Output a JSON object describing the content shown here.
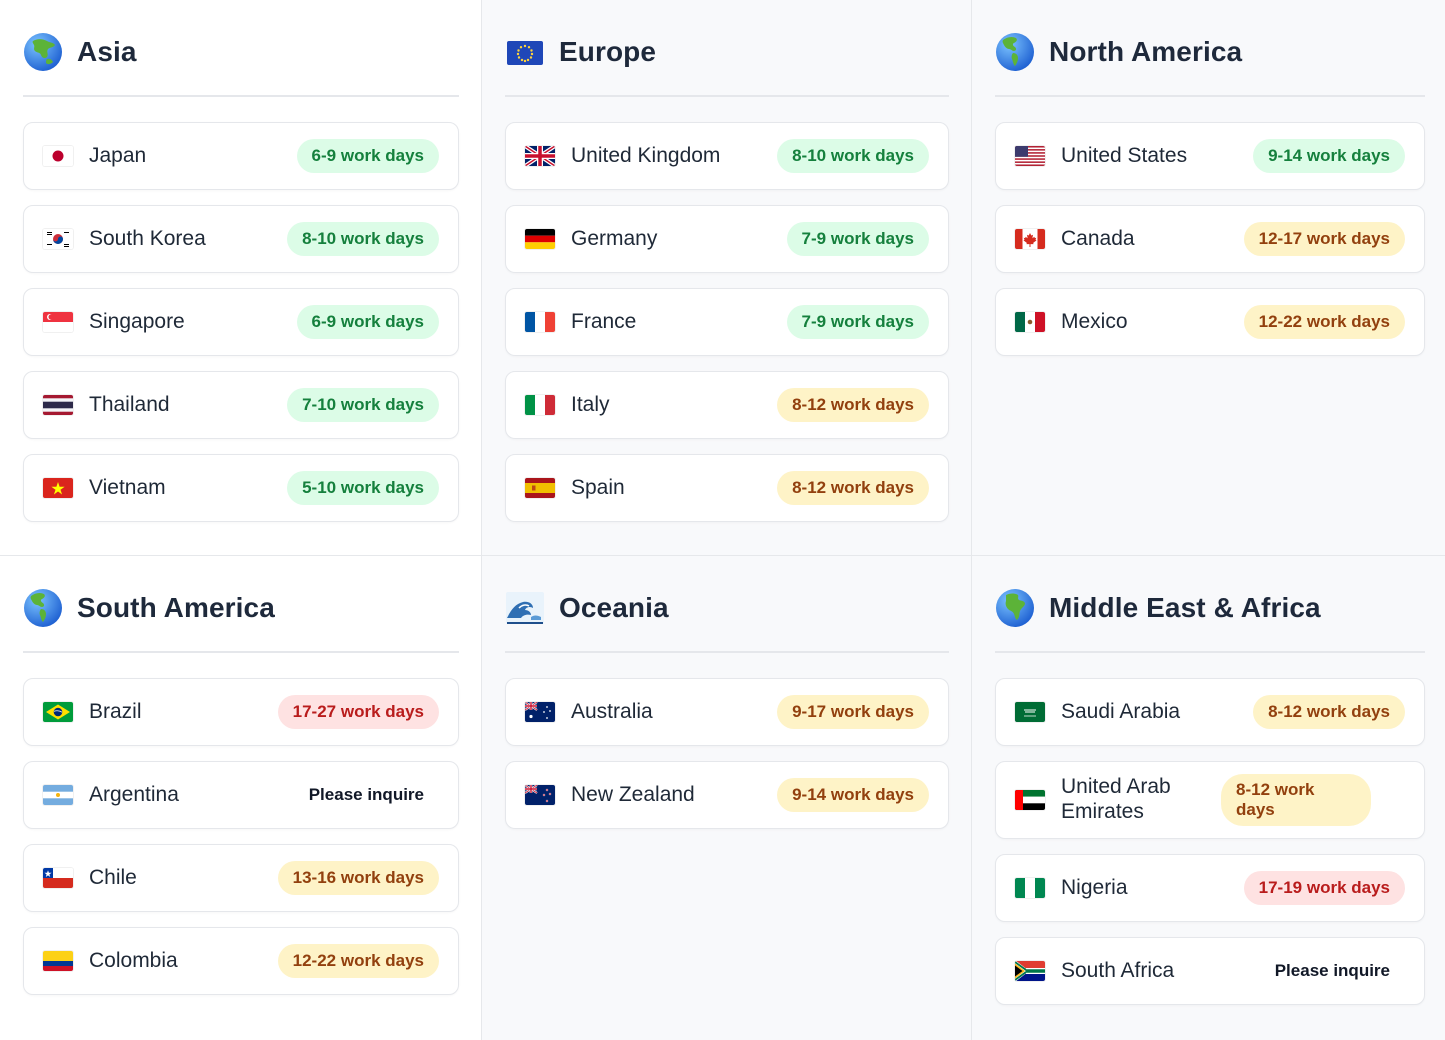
{
  "regions": [
    {
      "title": "Asia",
      "icon": "globe-asia-icon",
      "countries": [
        {
          "name": "Japan",
          "flag": "japan-flag-icon",
          "badge": "6-9 work days",
          "status": "green"
        },
        {
          "name": "South Korea",
          "flag": "south-korea-flag-icon",
          "badge": "8-10 work days",
          "status": "green"
        },
        {
          "name": "Singapore",
          "flag": "singapore-flag-icon",
          "badge": "6-9 work days",
          "status": "green"
        },
        {
          "name": "Thailand",
          "flag": "thailand-flag-icon",
          "badge": "7-10 work days",
          "status": "green"
        },
        {
          "name": "Vietnam",
          "flag": "vietnam-flag-icon",
          "badge": "5-10 work days",
          "status": "green"
        }
      ]
    },
    {
      "title": "Europe",
      "icon": "eu-flag-icon",
      "countries": [
        {
          "name": "United Kingdom",
          "flag": "uk-flag-icon",
          "badge": "8-10 work days",
          "status": "green"
        },
        {
          "name": "Germany",
          "flag": "germany-flag-icon",
          "badge": "7-9 work days",
          "status": "green"
        },
        {
          "name": "France",
          "flag": "france-flag-icon",
          "badge": "7-9 work days",
          "status": "green"
        },
        {
          "name": "Italy",
          "flag": "italy-flag-icon",
          "badge": "8-12 work days",
          "status": "yellow"
        },
        {
          "name": "Spain",
          "flag": "spain-flag-icon",
          "badge": "8-12 work days",
          "status": "yellow"
        }
      ]
    },
    {
      "title": "North America",
      "icon": "globe-americas-icon",
      "countries": [
        {
          "name": "United States",
          "flag": "usa-flag-icon",
          "badge": "9-14 work days",
          "status": "green"
        },
        {
          "name": "Canada",
          "flag": "canada-flag-icon",
          "badge": "12-17 work days",
          "status": "yellow"
        },
        {
          "name": "Mexico",
          "flag": "mexico-flag-icon",
          "badge": "12-22 work days",
          "status": "yellow"
        }
      ]
    },
    {
      "title": "South America",
      "icon": "globe-americas-icon",
      "countries": [
        {
          "name": "Brazil",
          "flag": "brazil-flag-icon",
          "badge": "17-27 work days",
          "status": "red"
        },
        {
          "name": "Argentina",
          "flag": "argentina-flag-icon",
          "badge": "Please inquire",
          "status": "plain"
        },
        {
          "name": "Chile",
          "flag": "chile-flag-icon",
          "badge": "13-16 work days",
          "status": "yellow"
        },
        {
          "name": "Colombia",
          "flag": "colombia-flag-icon",
          "badge": "12-22 work days",
          "status": "yellow"
        }
      ]
    },
    {
      "title": "Oceania",
      "icon": "wave-icon",
      "countries": [
        {
          "name": "Australia",
          "flag": "australia-flag-icon",
          "badge": "9-17 work days",
          "status": "yellow"
        },
        {
          "name": "New Zealand",
          "flag": "new-zealand-flag-icon",
          "badge": "9-14 work days",
          "status": "yellow"
        }
      ]
    },
    {
      "title": "Middle East & Africa",
      "icon": "globe-africa-icon",
      "countries": [
        {
          "name": "Saudi Arabia",
          "flag": "saudi-arabia-flag-icon",
          "badge": "8-12 work days",
          "status": "yellow"
        },
        {
          "name": "United Arab Emirates",
          "flag": "uae-flag-icon",
          "badge": "8-12 work days",
          "status": "yellow"
        },
        {
          "name": "Nigeria",
          "flag": "nigeria-flag-icon",
          "badge": "17-19 work days",
          "status": "red"
        },
        {
          "name": "South Africa",
          "flag": "south-africa-flag-icon",
          "badge": "Please inquire",
          "status": "plain"
        }
      ]
    }
  ],
  "colors": {
    "green_bg": "#dcfce7",
    "green_text": "#15803d",
    "yellow_bg": "#fef3c7",
    "yellow_text": "#92400e",
    "red_bg": "#fee2e2",
    "red_text": "#b91c1c"
  }
}
